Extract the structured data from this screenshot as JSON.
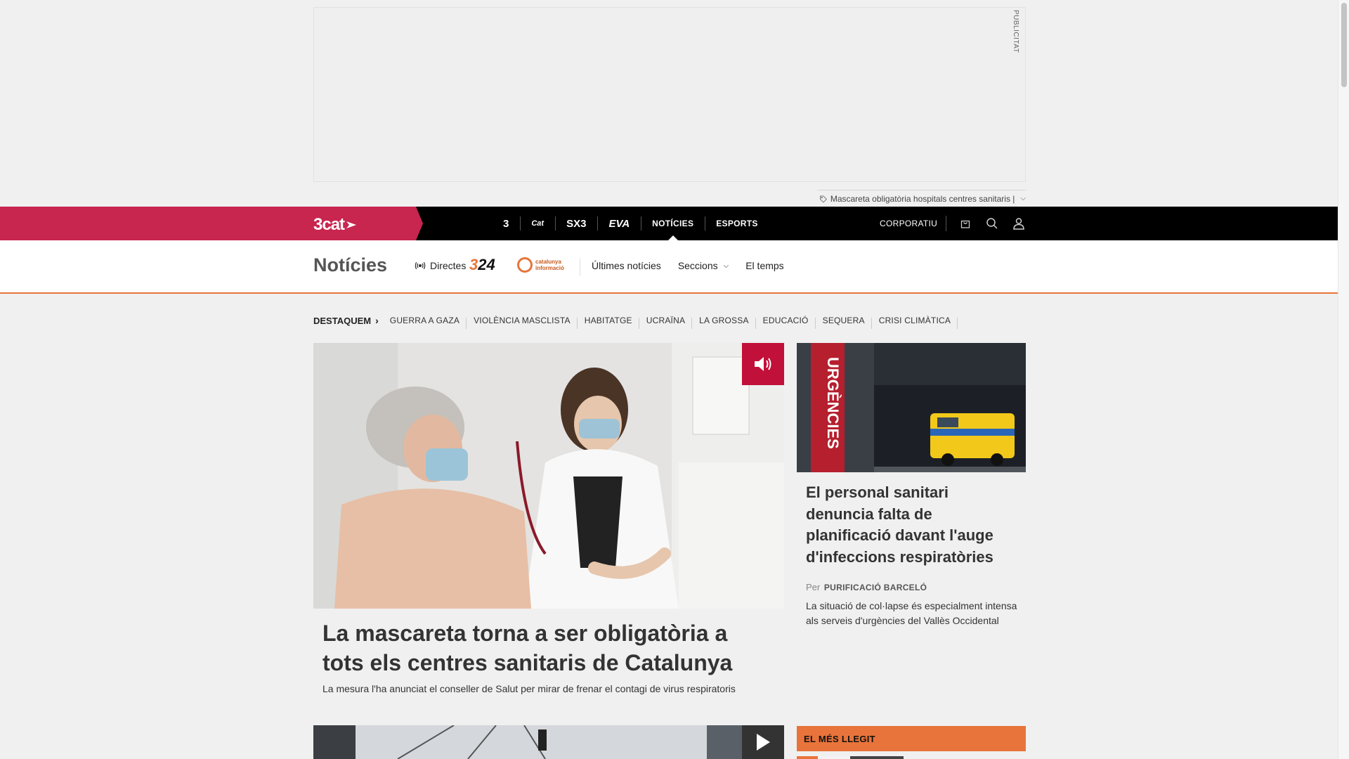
{
  "ad": {
    "label": "PUBLICITAT",
    "tagline": "Mascareta obligatòria hospitals centres sanitaris |"
  },
  "topnav": {
    "brand": "3cat",
    "channels": [
      {
        "label": "3",
        "name": "tv3"
      },
      {
        "label": "Cat",
        "name": "catradio"
      },
      {
        "label": "SX3",
        "name": "sx3"
      },
      {
        "label": "EVA",
        "name": "eva"
      },
      {
        "label": "NOTÍCIES",
        "name": "noticies"
      },
      {
        "label": "ESPORTS",
        "name": "esports"
      }
    ],
    "corporatiu": "CORPORATIU",
    "icons": [
      "shopping-bag-icon",
      "search-icon",
      "user-icon"
    ]
  },
  "section": {
    "title": "Notícies",
    "directes": "Directes",
    "logo_324": {
      "a": "3",
      "b": "24"
    },
    "logo_catinfo": {
      "line1": "catalunya",
      "line2": "informació"
    },
    "links": {
      "ultimes": "Últimes notícies",
      "seccions": "Seccions",
      "temps": "El temps"
    }
  },
  "trending": {
    "label": "DESTAQUEM",
    "items": [
      "GUERRA A GAZA",
      "VIOLÈNCIA MASCLISTA",
      "HABITATGE",
      "UCRAÏNA",
      "LA GROSSA",
      "EDUCACIÓ",
      "SEQUERA",
      "CRISI CLIMÀTICA"
    ]
  },
  "main_story": {
    "title": "La mascareta torna a ser obligatòria a tots els centres sanitaris de Catalunya",
    "subtitle": "La mesura l'ha anunciat el conseller de Salut per mirar de frenar el contagi de virus respiratoris",
    "badge_icon": "speaker-icon"
  },
  "side_story": {
    "title": "El personal sanitari denuncia falta de planificació davant l'auge d'infeccions respiratòries",
    "author_prefix": "Per",
    "author": "PURIFICACIÓ BARCELÓ",
    "subtitle": "La situació de col·lapse és especialment intensa als serveis d'urgències del Vallès Occidental",
    "image_text": "URGÈNCIES"
  },
  "most_read": {
    "label": "EL MÉS LLEGIT"
  },
  "colors": {
    "brand_red": "#c8254f",
    "accent_orange": "#e8743b",
    "audio_red": "#c1103a"
  }
}
